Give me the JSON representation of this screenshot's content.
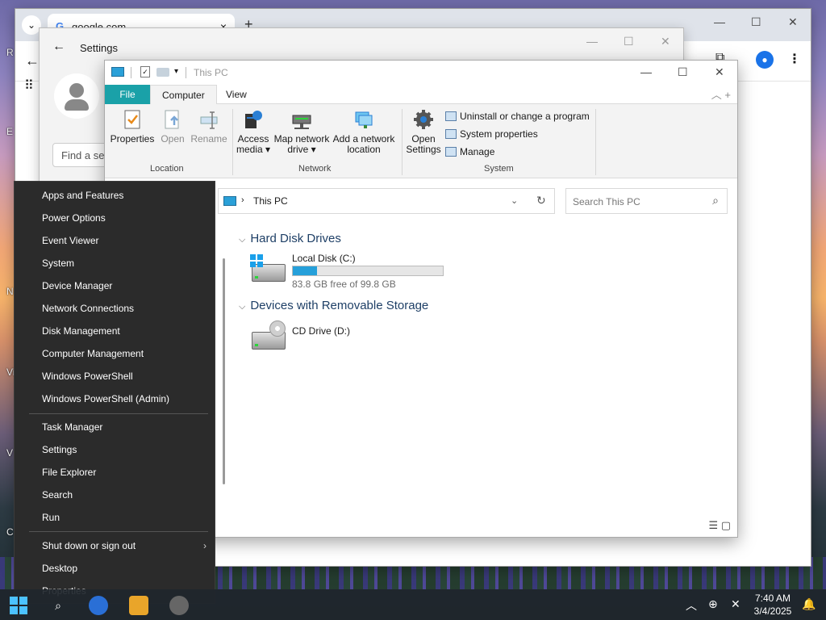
{
  "desktop": {
    "side_letters": [
      "R",
      "E",
      "N",
      "Vi",
      "V",
      "C"
    ]
  },
  "chrome": {
    "tab_title": "google.com",
    "tab_favicon": "G",
    "tab_close": "×",
    "new_tab": "+",
    "dropdown": "⌄",
    "minimize": "—",
    "maximize": "☐",
    "close": "✕",
    "back": "←",
    "extensions_icon": "puzzle-icon",
    "menu": "⋮",
    "apps": "⠿"
  },
  "settings": {
    "title": "Settings",
    "back": "←",
    "find_placeholder": "Find a setting",
    "minimize": "—",
    "maximize": "☐",
    "close": "✕"
  },
  "explorer": {
    "title": "This PC",
    "minimize": "—",
    "maximize": "☐",
    "close": "✕",
    "ribbon_tabs": [
      "File",
      "Computer",
      "View"
    ],
    "ribbon_tools": "︿  +",
    "location_group": {
      "label": "Location",
      "buttons": [
        "Properties",
        "Open",
        "Rename"
      ]
    },
    "network_group": {
      "label": "Network",
      "access_media": [
        "Access",
        "media ▾"
      ],
      "map_network_drive": [
        "Map network",
        "drive ▾"
      ],
      "add_network_location": [
        "Add a network",
        "location"
      ]
    },
    "system_group": {
      "label": "System",
      "open_settings": [
        "Open",
        "Settings"
      ],
      "uninstall": "Uninstall or change a program",
      "system_properties": "System properties",
      "manage": "Manage"
    },
    "address": {
      "separator": "›",
      "path": "This PC",
      "dropdown": "⌄",
      "refresh": "↻"
    },
    "search_placeholder": "Search This PC",
    "search_icon": "⌕",
    "hard_disk_section": "Hard Disk Drives",
    "removable_section": "Devices with Removable Storage",
    "section_toggle": "⌵",
    "drives": [
      {
        "name": "Local Disk (C:)",
        "free_text": "83.8 GB free of 99.8 GB",
        "used_fraction": 0.16
      }
    ],
    "cd_drive": {
      "name": "CD Drive (D:)"
    },
    "view_icons": "☰ ▢"
  },
  "winx_menu": {
    "group1": [
      "Apps and Features",
      "Power Options",
      "Event Viewer",
      "System",
      "Device Manager",
      "Network Connections",
      "Disk Management",
      "Computer Management",
      "Windows PowerShell",
      "Windows PowerShell (Admin)"
    ],
    "group2": [
      "Task Manager",
      "Settings",
      "File Explorer",
      "Search",
      "Run"
    ],
    "group3": [
      "Shut down or sign out",
      "Desktop",
      "Properties"
    ],
    "submenu_arrow": "›"
  },
  "taskbar": {
    "search": "⌕",
    "tray_chevron": "︿",
    "time": "7:40 AM",
    "date": "3/4/2025",
    "notification": "🔔"
  },
  "colors": {
    "ribbon_file_tab": "#1aa1a8",
    "progress_fill": "#26a0da",
    "menu_bg": "#2b2b2b",
    "start_blue": "#4cc2ff"
  }
}
